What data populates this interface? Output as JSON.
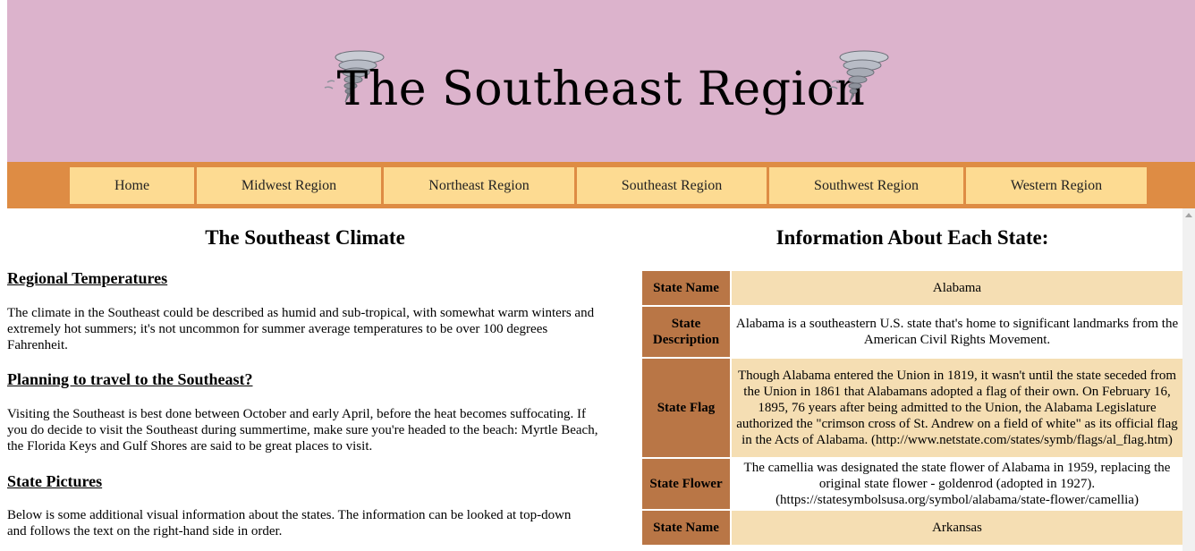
{
  "header": {
    "title": "The Southeast Region",
    "background": "#dcb3cc"
  },
  "nav": {
    "background": "#de8c44",
    "item_color": "#fddb92",
    "items": [
      {
        "label": "Home"
      },
      {
        "label": "Midwest Region"
      },
      {
        "label": "Northeast Region"
      },
      {
        "label": "Southeast Region"
      },
      {
        "label": "Southwest Region"
      },
      {
        "label": "Western Region"
      }
    ]
  },
  "climate": {
    "heading": "The Southeast Climate",
    "sections": [
      {
        "title": "Regional Temperatures",
        "text": "The climate in the Southeast could be described as humid and sub-tropical, with somewhat warm winters and extremely hot summers; it's not uncommon for summer average temperatures to be over 100 degrees Fahrenheit."
      },
      {
        "title": "Planning to travel to the Southeast?",
        "text": "Visiting the Southeast is best done between October and early April, before the heat becomes suffocating. If you do decide to visit the Southeast during summertime, make sure you're headed to the beach: Myrtle Beach, the Florida Keys and Gulf Shores are said to be great places to visit."
      },
      {
        "title": "State Pictures",
        "text": "Below is some additional visual information about the states. The information can be looked at top-down and follows the text on the right-hand side in order."
      }
    ]
  },
  "states": {
    "heading": "Information About Each State:",
    "label_color": "#b97646",
    "shade_color": "#f5deb3",
    "rows": [
      {
        "label": "State Name",
        "value": "Alabama"
      },
      {
        "label": "State Description",
        "value": "Alabama is a southeastern U.S. state that's home to significant landmarks from the American Civil Rights Movement."
      },
      {
        "label": "State Flag",
        "value": "Though Alabama entered the Union in 1819, it wasn't until the state seceded from the Union in 1861 that Alabamans adopted a flag of their own. On February 16, 1895, 76 years after being admitted to the Union, the Alabama Legislature authorized the \"crimson cross of St. Andrew on a field of white\" as its official flag in the Acts of Alabama. (http://www.netstate.com/states/symb/flags/al_flag.htm)"
      },
      {
        "label": "State Flower",
        "value": "The camellia was designated the state flower of Alabama in 1959, replacing the original state flower - goldenrod (adopted in 1927). (https://statesymbolsusa.org/symbol/alabama/state-flower/camellia)"
      },
      {
        "label": "State Name",
        "value": "Arkansas"
      }
    ]
  },
  "icons": {
    "header_left": "tornado-icon",
    "header_right": "tornado-icon"
  }
}
